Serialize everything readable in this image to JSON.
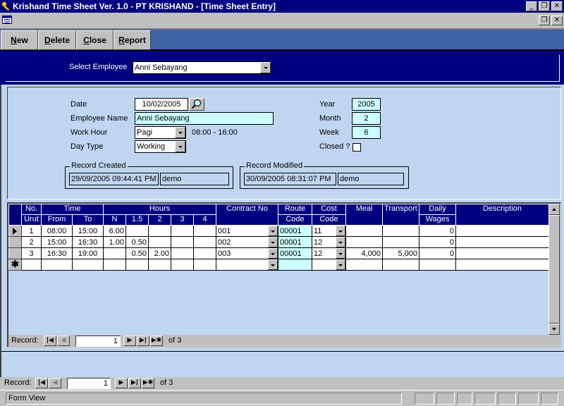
{
  "window": {
    "title": "Krishand Time Sheet Ver. 1.0 - PT KRISHAND - [Time Sheet Entry]",
    "controls": {
      "minimize": "_",
      "restore": "❐",
      "close": "✕"
    }
  },
  "toolbar": {
    "new_label": "New",
    "new_key": "N",
    "new_rest": "ew",
    "delete_key": "D",
    "delete_rest": "elete",
    "close_key": "C",
    "close_rest": "lose",
    "report_key": "R",
    "report_rest": "eport"
  },
  "selector": {
    "label": "Select Employee",
    "value": "Anni Sebayang"
  },
  "form": {
    "date_label": "Date",
    "date_value": "10/02/2005",
    "employee_name_label": "Employee Name",
    "employee_name_value": "Anni Sebayang",
    "work_hour_label": "Work Hour",
    "work_hour_value": "Pagi",
    "work_hour_range": "08:00  -  16:00",
    "day_type_label": "Day Type",
    "day_type_value": "Working",
    "year_label": "Year",
    "year_value": "2005",
    "month_label": "Month",
    "month_value": "2",
    "week_label": "Week",
    "week_value": "6",
    "closed_label": "Closed ?",
    "closed_checked": false,
    "record_created": {
      "title": "Record Created",
      "datetime": "29/09/2005 09:44:41 PM",
      "user": "demo"
    },
    "record_modified": {
      "title": "Record Modified",
      "datetime": "30/09/2005 08:31:07 PM",
      "user": "demo"
    }
  },
  "grid": {
    "headers": {
      "no": "No.",
      "urut": "Urut",
      "time": "Time",
      "from": "From",
      "to": "To",
      "hours": "Hours",
      "n": "N",
      "h15": "1.5",
      "h2": "2",
      "h3": "3",
      "h4": "4",
      "contract_no": "Contract No",
      "route": "Route",
      "route_code": "Code",
      "cost": "Cost",
      "cost_code": "Code",
      "meal": "Meal",
      "transport": "Transport",
      "daily": "Daily",
      "wages": "Wages",
      "description": "Description"
    },
    "rows": [
      {
        "urut": "1",
        "from": "08:00",
        "to": "15:00",
        "n": "6.00",
        "h15": "",
        "h2": "",
        "h3": "",
        "h4": "",
        "contract_no": "001",
        "route_code": "00001",
        "cost_code": "11",
        "meal": "",
        "transport": "",
        "daily_wages": "0",
        "description": ""
      },
      {
        "urut": "2",
        "from": "15:00",
        "to": "16:30",
        "n": "1.00",
        "h15": "0.50",
        "h2": "",
        "h3": "",
        "h4": "",
        "contract_no": "002",
        "route_code": "00001",
        "cost_code": "12",
        "meal": "",
        "transport": "",
        "daily_wages": "0",
        "description": ""
      },
      {
        "urut": "3",
        "from": "16:30",
        "to": "19:00",
        "n": "",
        "h15": "0.50",
        "h2": "2.00",
        "h3": "",
        "h4": "",
        "contract_no": "003",
        "route_code": "00001",
        "cost_code": "12",
        "meal": "4,000",
        "transport": "5,000",
        "daily_wages": "0",
        "description": ""
      }
    ],
    "new_row_marker": "✱"
  },
  "subform_nav": {
    "label": "Record:",
    "current": "1",
    "of_text": "of  3"
  },
  "main_nav": {
    "label": "Record:",
    "current": "1",
    "of_text": "of  3"
  },
  "statusbar": {
    "text": "Form View"
  },
  "colors": {
    "title_bar": "#000080",
    "toolbar": "#3e62a6",
    "form_bg": "#c0d6f0",
    "highlight_field": "#ccffff"
  }
}
